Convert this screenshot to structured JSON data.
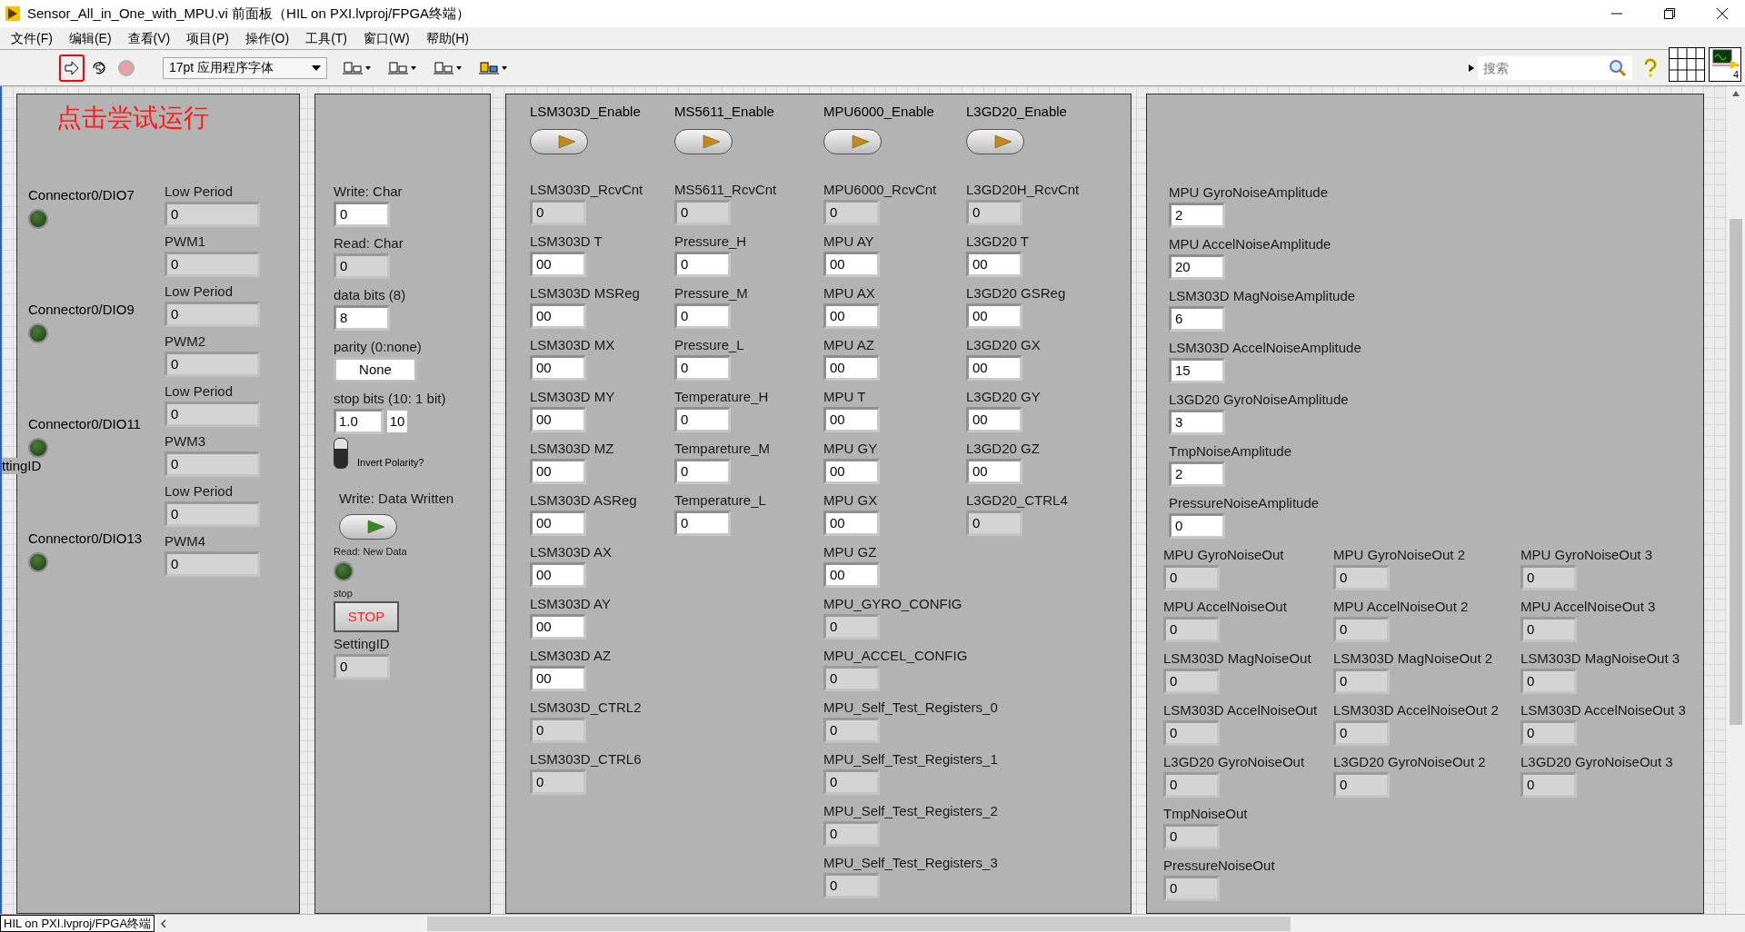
{
  "window": {
    "title": "Sensor_All_in_One_with_MPU.vi 前面板（HIL on PXI.lvproj/FPGA终端）"
  },
  "menu": [
    "文件(F)",
    "编辑(E)",
    "查看(V)",
    "项目(P)",
    "操作(O)",
    "工具(T)",
    "窗口(W)",
    "帮助(H)"
  ],
  "toolbar": {
    "font": "17pt 应用程序字体",
    "search": {
      "placeholder": "搜索"
    },
    "icon_number": "4"
  },
  "annotation": "点击尝试运行",
  "cut_label": "ttingID",
  "panel_1": {
    "connectors": [
      {
        "label": "Connector0/DIO7",
        "on": false
      },
      {
        "label": "Connector0/DIO9",
        "on": false
      },
      {
        "label": "Connector0/DIO11",
        "on": false
      },
      {
        "label": "Connector0/DIO13",
        "on": false
      }
    ],
    "fields": [
      {
        "label": "Low Period",
        "value": "0",
        "kind": "indicator"
      },
      {
        "label": "PWM1",
        "value": "0",
        "kind": "indicator"
      },
      {
        "label": "Low Period",
        "value": "0",
        "kind": "indicator"
      },
      {
        "label": "PWM2",
        "value": "0",
        "kind": "indicator"
      },
      {
        "label": "Low Period",
        "value": "0",
        "kind": "indicator"
      },
      {
        "label": "PWM3",
        "value": "0",
        "kind": "indicator"
      },
      {
        "label": "Low Period",
        "value": "0",
        "kind": "indicator"
      },
      {
        "label": "PWM4",
        "value": "0",
        "kind": "indicator"
      }
    ]
  },
  "panel_2": [
    {
      "kind": "control",
      "label": "Write: Char",
      "value": "0"
    },
    {
      "kind": "indicator",
      "label": "Read: Char",
      "value": "0"
    },
    {
      "kind": "control",
      "label": "data bits (8)",
      "value": "8"
    },
    {
      "kind": "ring",
      "label": "parity (0:none)",
      "value": "None"
    },
    {
      "kind": "pair",
      "label": "stop bits (10: 1 bit)",
      "value": "1.0",
      "value_2": "10"
    },
    {
      "kind": "toggle",
      "label": "Invert Polarity?",
      "on": false
    },
    {
      "kind": "switch",
      "label": "Write: Data Written"
    },
    {
      "kind": "led",
      "label": "Read: New Data",
      "on": false
    },
    {
      "kind": "button",
      "label": "stop",
      "value": "STOP"
    },
    {
      "kind": "indicator",
      "label": "SettingID",
      "value": "0"
    }
  ],
  "panel_3": {
    "switches": [
      {
        "label": "LSM303D_Enable"
      },
      {
        "label": "MS5611_Enable"
      },
      {
        "label": "MPU6000_Enable"
      },
      {
        "label": "L3GD20_Enable"
      }
    ],
    "columns": [
      [
        {
          "label": "LSM303D_RcvCnt",
          "value": "0",
          "kind": "indicator"
        },
        {
          "label": "LSM303D T",
          "value": "00",
          "kind": "control"
        },
        {
          "label": "LSM303D MSReg",
          "value": "00",
          "kind": "control"
        },
        {
          "label": "LSM303D MX",
          "value": "00",
          "kind": "control"
        },
        {
          "label": "LSM303D MY",
          "value": "00",
          "kind": "control"
        },
        {
          "label": "LSM303D MZ",
          "value": "00",
          "kind": "control"
        },
        {
          "label": "LSM303D ASReg",
          "value": "00",
          "kind": "control"
        },
        {
          "label": "LSM303D AX",
          "value": "00",
          "kind": "control"
        },
        {
          "label": "LSM303D AY",
          "value": "00",
          "kind": "control"
        },
        {
          "label": "LSM303D AZ",
          "value": "00",
          "kind": "control"
        },
        {
          "label": "LSM303D_CTRL2",
          "value": "0",
          "kind": "indicator"
        },
        {
          "label": "LSM303D_CTRL6",
          "value": "0",
          "kind": "indicator"
        }
      ],
      [
        {
          "label": "MS5611_RcvCnt",
          "value": "0",
          "kind": "indicator"
        },
        {
          "label": "Pressure_H",
          "value": "0",
          "kind": "control"
        },
        {
          "label": "Pressure_M",
          "value": "0",
          "kind": "control"
        },
        {
          "label": "Pressure_L",
          "value": "0",
          "kind": "control"
        },
        {
          "label": "Temperature_H",
          "value": "0",
          "kind": "control"
        },
        {
          "label": "Tempareture_M",
          "value": "0",
          "kind": "control"
        },
        {
          "label": "Temperature_L",
          "value": "0",
          "kind": "control"
        }
      ],
      [
        {
          "label": "MPU6000_RcvCnt",
          "value": "0",
          "kind": "indicator"
        },
        {
          "label": "MPU AY",
          "value": "00",
          "kind": "control"
        },
        {
          "label": "MPU AX",
          "value": "00",
          "kind": "control"
        },
        {
          "label": "MPU AZ",
          "value": "00",
          "kind": "control"
        },
        {
          "label": "MPU T",
          "value": "00",
          "kind": "control"
        },
        {
          "label": "MPU GY",
          "value": "00",
          "kind": "control"
        },
        {
          "label": "MPU GX",
          "value": "00",
          "kind": "control"
        },
        {
          "label": "MPU GZ",
          "value": "00",
          "kind": "control"
        },
        {
          "label": "MPU_GYRO_CONFIG",
          "value": "0",
          "kind": "indicator"
        },
        {
          "label": "MPU_ACCEL_CONFIG",
          "value": "0",
          "kind": "indicator"
        },
        {
          "label": "MPU_Self_Test_Registers_0",
          "value": "0",
          "kind": "indicator"
        },
        {
          "label": "MPU_Self_Test_Registers_1",
          "value": "0",
          "kind": "indicator"
        },
        {
          "label": "MPU_Self_Test_Registers_2",
          "value": "0",
          "kind": "indicator"
        },
        {
          "label": "MPU_Self_Test_Registers_3",
          "value": "0",
          "kind": "indicator"
        }
      ],
      [
        {
          "label": "L3GD20H_RcvCnt",
          "value": "0",
          "kind": "indicator"
        },
        {
          "label": "L3GD20 T",
          "value": "00",
          "kind": "control"
        },
        {
          "label": "L3GD20 GSReg",
          "value": "00",
          "kind": "control"
        },
        {
          "label": "L3GD20 GX",
          "value": "00",
          "kind": "control"
        },
        {
          "label": "L3GD20 GY",
          "value": "00",
          "kind": "control"
        },
        {
          "label": "L3GD20 GZ",
          "value": "00",
          "kind": "control"
        },
        {
          "label": "L3GD20_CTRL4",
          "value": "0",
          "kind": "indicator"
        }
      ]
    ]
  },
  "panel_4": {
    "fields": [
      {
        "label": "MPU GyroNoiseAmplitude",
        "value": "2",
        "kind": "control"
      },
      {
        "label": "MPU AccelNoiseAmplitude",
        "value": "20",
        "kind": "control"
      },
      {
        "label": "LSM303D MagNoiseAmplitude",
        "value": "6",
        "kind": "control"
      },
      {
        "label": "LSM303D AccelNoiseAmplitude",
        "value": "15",
        "kind": "control"
      },
      {
        "label": "L3GD20 GyroNoiseAmplitude",
        "value": "3",
        "kind": "control"
      },
      {
        "label": "TmpNoiseAmplitude",
        "value": "2",
        "kind": "control"
      },
      {
        "label": "PressureNoiseAmplitude",
        "value": "0",
        "kind": "control"
      }
    ],
    "output_rows": [
      [
        {
          "label": "MPU GyroNoiseOut",
          "value": "0",
          "kind": "indicator"
        },
        {
          "label": "MPU GyroNoiseOut 2",
          "value": "0",
          "kind": "indicator"
        },
        {
          "label": "MPU GyroNoiseOut 3",
          "value": "0",
          "kind": "indicator"
        }
      ],
      [
        {
          "label": "MPU AccelNoiseOut",
          "value": "0",
          "kind": "indicator"
        },
        {
          "label": "MPU AccelNoiseOut 2",
          "value": "0",
          "kind": "indicator"
        },
        {
          "label": "MPU AccelNoiseOut 3",
          "value": "0",
          "kind": "indicator"
        }
      ],
      [
        {
          "label": "LSM303D MagNoiseOut",
          "value": "0",
          "kind": "indicator"
        },
        {
          "label": "LSM303D MagNoiseOut 2",
          "value": "0",
          "kind": "indicator"
        },
        {
          "label": "LSM303D MagNoiseOut 3",
          "value": "0",
          "kind": "indicator"
        }
      ],
      [
        {
          "label": "LSM303D AccelNoiseOut",
          "value": "0",
          "kind": "indicator"
        },
        {
          "label": "LSM303D AccelNoiseOut 2",
          "value": "0",
          "kind": "indicator"
        },
        {
          "label": "LSM303D AccelNoiseOut 3",
          "value": "0",
          "kind": "indicator"
        }
      ],
      [
        {
          "label": "L3GD20 GyroNoiseOut",
          "value": "0",
          "kind": "indicator"
        },
        {
          "label": "L3GD20 GyroNoiseOut 2",
          "value": "0",
          "kind": "indicator"
        },
        {
          "label": "L3GD20 GyroNoiseOut 3",
          "value": "0",
          "kind": "indicator"
        }
      ],
      [
        {
          "label": "TmpNoiseOut",
          "value": "0",
          "kind": "indicator"
        }
      ],
      [
        {
          "label": "PressureNoiseOut",
          "value": "0",
          "kind": "indicator"
        }
      ]
    ]
  },
  "status_bar": {
    "target": "HIL on PXI.lvproj/FPGA终端"
  }
}
